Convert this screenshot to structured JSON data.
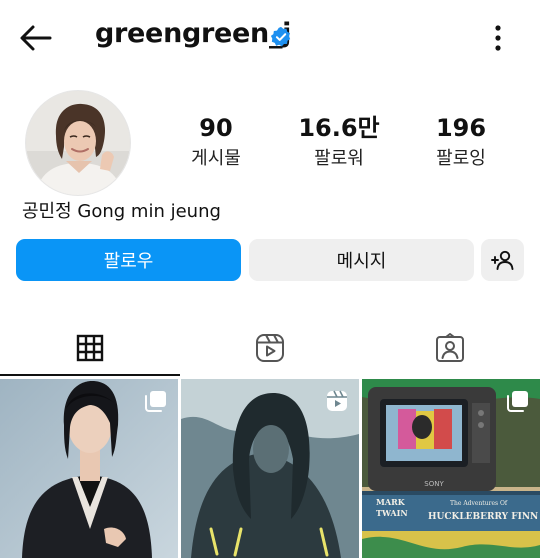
{
  "header": {
    "username": "greengreen_j",
    "verified_icon": "verified-badge-icon",
    "back_icon": "back-arrow-icon",
    "more_icon": "more-vertical-icon"
  },
  "profile": {
    "avatar_icon": "avatar",
    "stats": [
      {
        "value": "90",
        "label": "게시물"
      },
      {
        "value": "16.6만",
        "label": "팔로워"
      },
      {
        "value": "196",
        "label": "팔로잉"
      }
    ],
    "display_name": "공민정 Gong min jeung"
  },
  "actions": {
    "follow_label": "팔로우",
    "message_label": "메시지",
    "add_user_icon": "add-user-icon"
  },
  "tabs": [
    {
      "icon": "grid-icon",
      "active": true
    },
    {
      "icon": "reels-icon",
      "active": false
    },
    {
      "icon": "tagged-icon",
      "active": false
    }
  ],
  "posts": [
    {
      "badge_icon": "multi-photo-icon"
    },
    {
      "badge_icon": "reels-icon"
    },
    {
      "badge_icon": "multi-photo-icon",
      "caption_lines": [
        "MARK",
        "TWAIN",
        "The Adventures Of",
        "HUCKLEBERRY FINN"
      ],
      "tv_brand": "SONY"
    }
  ],
  "colors": {
    "accent": "#0a95f6",
    "verified": "#1e90f0",
    "secondary_button": "#efefef"
  }
}
